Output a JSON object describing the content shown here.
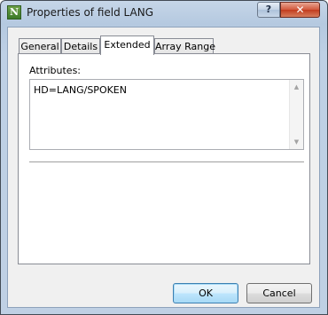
{
  "window": {
    "title": "Properties of field LANG",
    "app_icon_letter": "N",
    "help_glyph": "?",
    "close_glyph": "✕"
  },
  "tabs": [
    {
      "label": "General",
      "active": false
    },
    {
      "label": "Details",
      "active": false
    },
    {
      "label": "Extended",
      "active": true
    },
    {
      "label": "Array Range",
      "active": false
    }
  ],
  "extended": {
    "attributes_label": "Attributes:",
    "attributes_value": "HD=LANG/SPOKEN"
  },
  "buttons": {
    "ok": "OK",
    "cancel": "Cancel"
  },
  "colors": {
    "titlebar": "#bcd0e6",
    "dialog_bg": "#f0f0f0",
    "close_button": "#c94a2c",
    "default_button_border": "#3c7fb1"
  },
  "icons": {
    "app": "app-logo-icon",
    "help": "help-icon",
    "close": "close-icon",
    "scroll_up": "scroll-up-arrow-icon",
    "scroll_down": "scroll-down-arrow-icon"
  }
}
